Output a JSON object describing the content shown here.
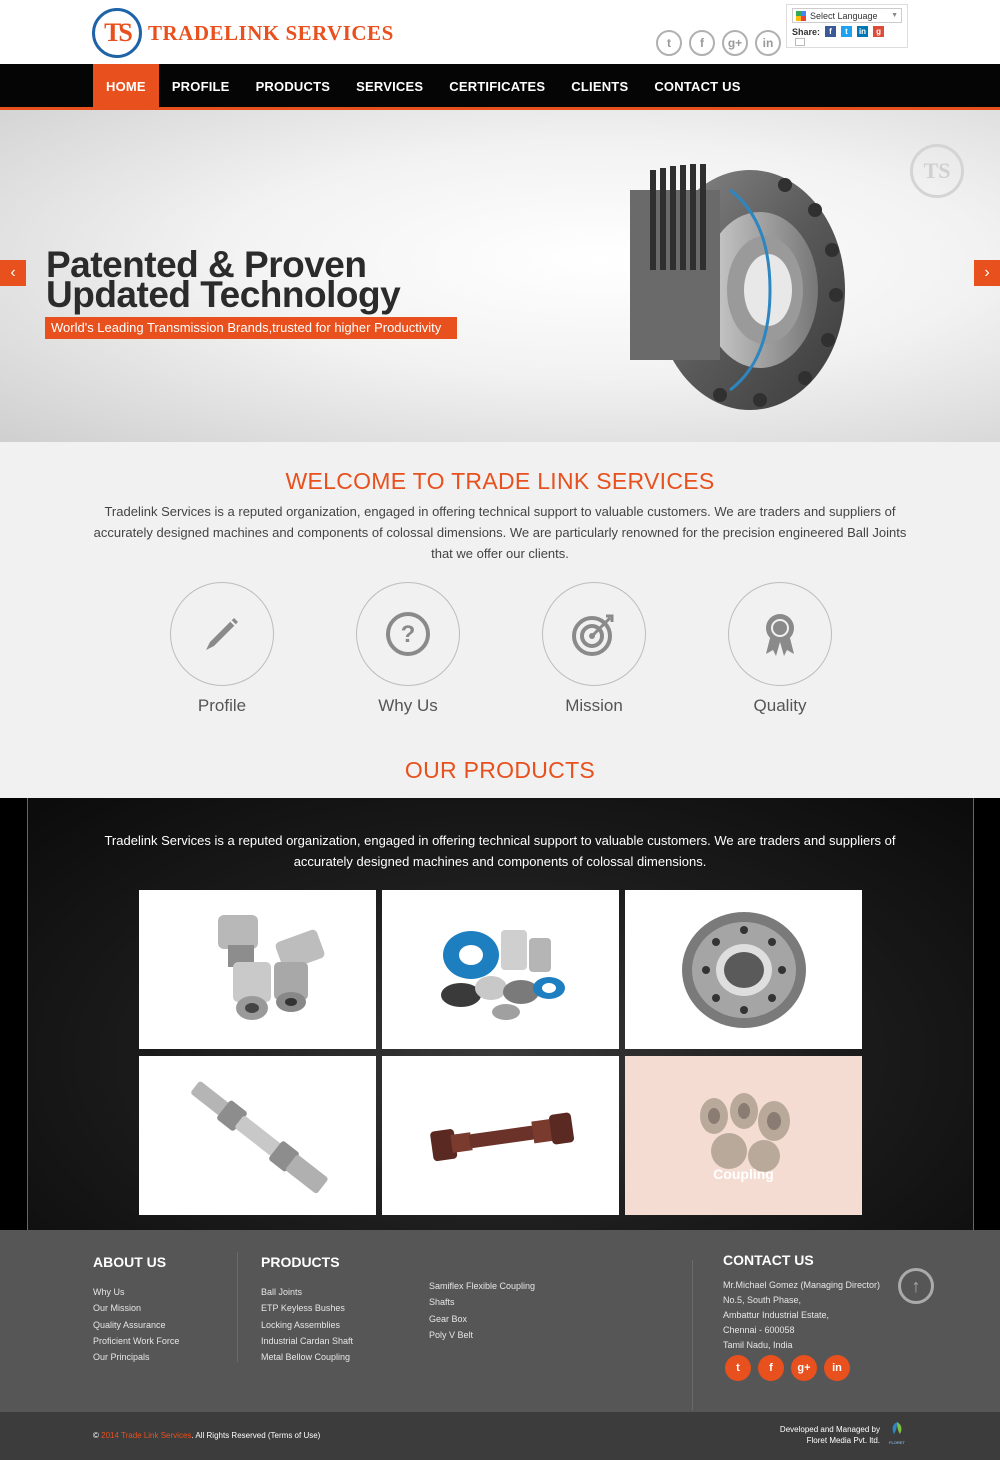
{
  "brand": {
    "logo_mark": "TS",
    "name": "TRADELINK SERVICES"
  },
  "header": {
    "social": [
      "twitter-icon",
      "facebook-icon",
      "google-plus-icon",
      "linkedin-icon"
    ],
    "translate": {
      "label": "Select Language",
      "arrow": "▼"
    },
    "share_label": "Share:"
  },
  "nav": {
    "items": [
      "HOME",
      "PROFILE",
      "PRODUCTS",
      "SERVICES",
      "CERTIFICATES",
      "CLIENTS",
      "CONTACT US"
    ],
    "active": "HOME"
  },
  "slider": {
    "title_line1": "Patented & Proven",
    "title_line2": "Updated Technology",
    "subtitle": "World's Leading Transmission Brands,trusted for higher Productivity",
    "prev": "‹",
    "next": "›",
    "watermark": "TS"
  },
  "welcome": {
    "title": "WELCOME TO TRADE LINK SERVICES",
    "text": "Tradelink Services is a reputed organization, engaged in offering technical support to valuable customers. We are traders and suppliers of accurately designed machines and components of colossal dimensions. We are particularly renowned for the precision engineered Ball Joints that we offer our clients.",
    "features": [
      {
        "label": "Profile",
        "icon": "pencil-icon"
      },
      {
        "label": "Why Us",
        "icon": "question-icon"
      },
      {
        "label": "Mission",
        "icon": "target-icon"
      },
      {
        "label": "Quality",
        "icon": "award-icon"
      }
    ]
  },
  "products": {
    "title": "OUR PRODUCTS",
    "text": "Tradelink Services is a reputed organization, engaged in offering technical support to valuable customers. We are traders and suppliers of accurately designed machines and components of colossal dimensions.",
    "tiles": [
      {
        "name": "universal-joints",
        "caption": ""
      },
      {
        "name": "keyless-bushes",
        "caption": ""
      },
      {
        "name": "locking-assembly",
        "caption": ""
      },
      {
        "name": "cardan-joint",
        "caption": ""
      },
      {
        "name": "cardan-shaft",
        "caption": ""
      },
      {
        "name": "bellow-coupling",
        "caption": "Coupling"
      }
    ]
  },
  "footer": {
    "about": {
      "title": "ABOUT US",
      "links": [
        "Why Us",
        "Our Mission",
        "Quality Assurance",
        "Proficient Work Force",
        "Our Principals"
      ]
    },
    "products": {
      "title": "PRODUCTS",
      "links_col1": [
        "Ball Joints",
        "ETP Keyless Bushes",
        "Locking Assemblies",
        "Industrial Cardan Shaft",
        "Metal Bellow Coupling"
      ],
      "links_col2": [
        "Samiflex Flexible Coupling",
        "Shafts",
        "Gear Box",
        "Poly V Belt"
      ]
    },
    "contact": {
      "title": "CONTACT US",
      "lines": [
        "Mr.Michael Gomez (Managing Director)",
        "No.5, South Phase,",
        "Ambattur Industrial Estate,",
        "Chennai - 600058",
        "Tamil Nadu, India"
      ]
    },
    "scroll_up": "↑",
    "social": [
      "twitter-icon",
      "facebook-icon",
      "google-plus-icon",
      "linkedin-icon"
    ]
  },
  "bottom": {
    "copy_prefix": "© ",
    "copy_org": "2014 Trade Link Services",
    "copy_suffix": ". All Rights Reserved (Terms of Use)",
    "dev_line1": "Developed and Managed by",
    "dev_line2": "Floret Media Pvt. ltd.",
    "floret_label": "FLORET"
  },
  "colors": {
    "accent": "#e8501e",
    "nav_bg": "#050505",
    "footer_bg": "#565656",
    "bottom_bg": "#3c3c3c"
  }
}
